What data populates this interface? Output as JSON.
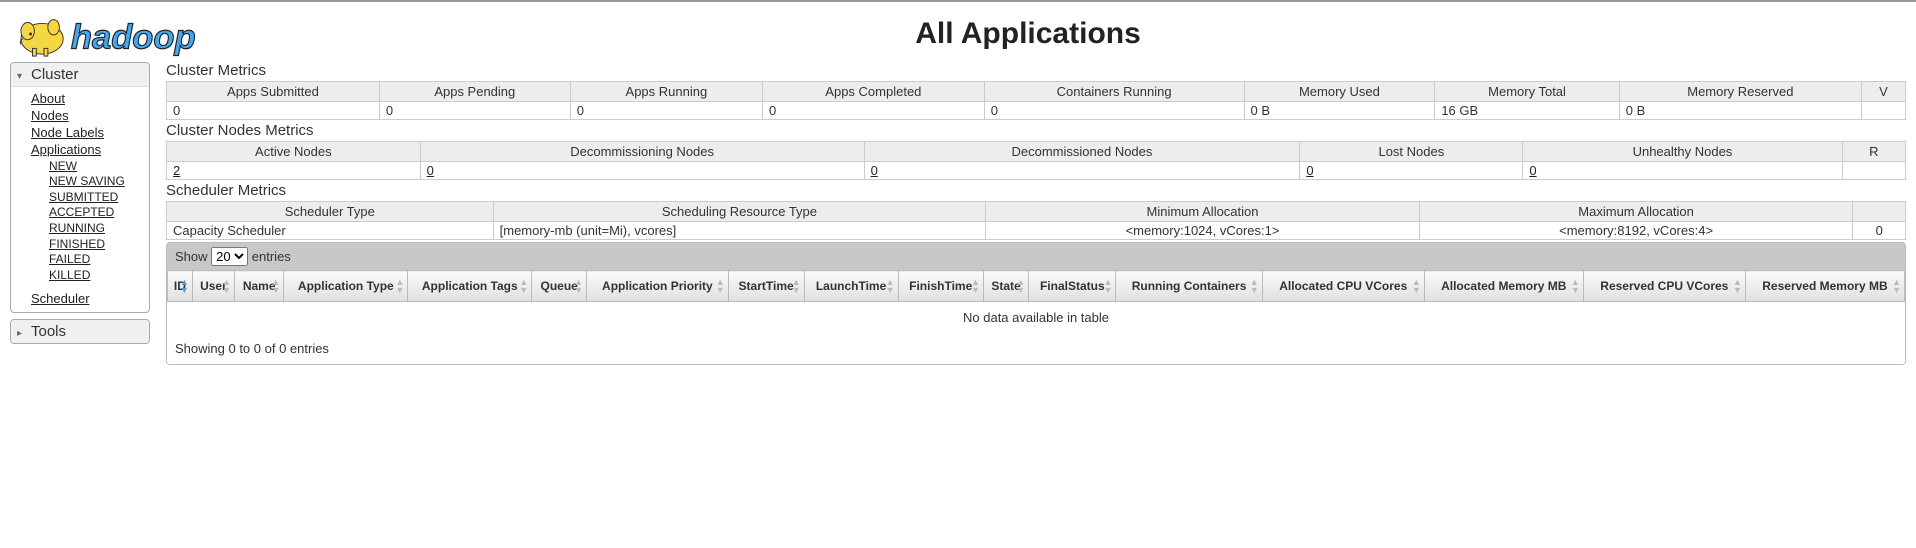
{
  "header": {
    "title": "All Applications"
  },
  "sidebar": {
    "cluster_label": "Cluster",
    "tools_label": "Tools",
    "links": {
      "about": "About",
      "nodes": "Nodes",
      "node_labels": "Node Labels",
      "applications": "Applications",
      "new": "NEW",
      "new_saving": "NEW SAVING",
      "submitted": "SUBMITTED",
      "accepted": "ACCEPTED",
      "running": "RUNNING",
      "finished": "FINISHED",
      "failed": "FAILED",
      "killed": "KILLED",
      "scheduler": "Scheduler"
    }
  },
  "cluster_metrics": {
    "title": "Cluster Metrics",
    "headers": {
      "apps_submitted": "Apps Submitted",
      "apps_pending": "Apps Pending",
      "apps_running": "Apps Running",
      "apps_completed": "Apps Completed",
      "containers_running": "Containers Running",
      "memory_used": "Memory Used",
      "memory_total": "Memory Total",
      "memory_reserved": "Memory Reserved",
      "vcores": "V"
    },
    "values": {
      "apps_submitted": "0",
      "apps_pending": "0",
      "apps_running": "0",
      "apps_completed": "0",
      "containers_running": "0",
      "memory_used": "0 B",
      "memory_total": "16 GB",
      "memory_reserved": "0 B",
      "vcores": ""
    }
  },
  "cluster_nodes_metrics": {
    "title": "Cluster Nodes Metrics",
    "headers": {
      "active": "Active Nodes",
      "decommissioning": "Decommissioning Nodes",
      "decommissioned": "Decommissioned Nodes",
      "lost": "Lost Nodes",
      "unhealthy": "Unhealthy Nodes",
      "rebooted": "R"
    },
    "values": {
      "active": "2",
      "decommissioning": "0",
      "decommissioned": "0",
      "lost": "0",
      "unhealthy": "0",
      "rebooted": ""
    }
  },
  "scheduler_metrics": {
    "title": "Scheduler Metrics",
    "headers": {
      "type": "Scheduler Type",
      "resource_type": "Scheduling Resource Type",
      "min_alloc": "Minimum Allocation",
      "max_alloc": "Maximum Allocation",
      "extra": ""
    },
    "values": {
      "type": "Capacity Scheduler",
      "resource_type": "[memory-mb (unit=Mi), vcores]",
      "min_alloc": "<memory:1024, vCores:1>",
      "max_alloc": "<memory:8192, vCores:4>",
      "extra": "0"
    }
  },
  "apps_table": {
    "show_label": "Show",
    "entries_label": "entries",
    "page_size": "20",
    "columns": {
      "id": "ID",
      "user": "User",
      "name": "Name",
      "app_type": "Application Type",
      "app_tags": "Application Tags",
      "queue": "Queue",
      "app_priority": "Application Priority",
      "start_time": "StartTime",
      "launch_time": "LaunchTime",
      "finish_time": "FinishTime",
      "state": "State",
      "final_status": "FinalStatus",
      "running_containers": "Running Containers",
      "alloc_cpu": "Allocated CPU VCores",
      "alloc_mem": "Allocated Memory MB",
      "res_cpu": "Reserved CPU VCores",
      "res_mem": "Reserved Memory MB"
    },
    "empty_message": "No data available in table",
    "info": "Showing 0 to 0 of 0 entries"
  }
}
